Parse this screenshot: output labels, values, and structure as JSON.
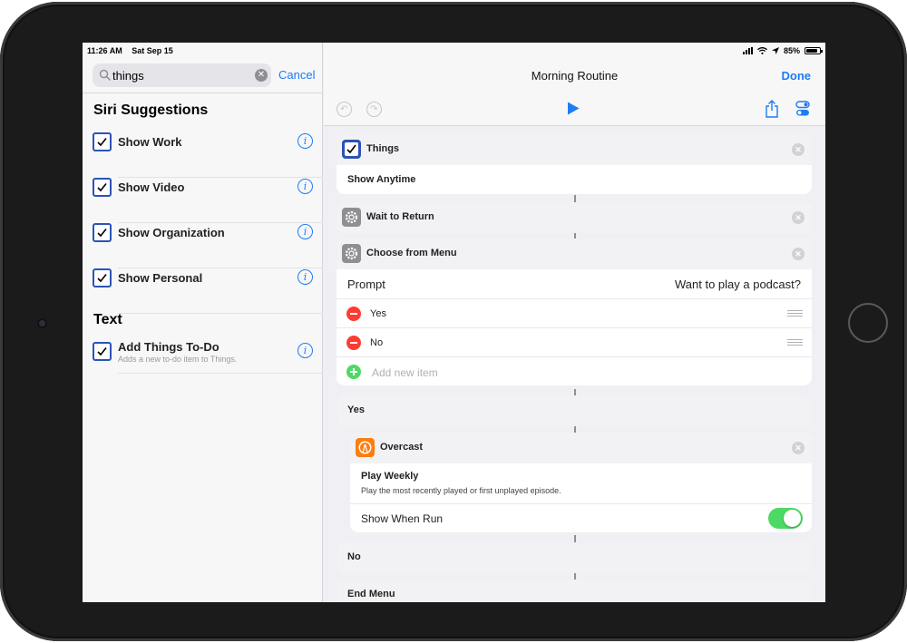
{
  "status_bar": {
    "time": "11:26 AM",
    "date": "Sat Sep 15",
    "battery": "85%"
  },
  "sidebar": {
    "search_value": "things",
    "cancel_label": "Cancel",
    "siri_section_title": "Siri Suggestions",
    "siri_items": [
      {
        "label": "Show Work"
      },
      {
        "label": "Show Video"
      },
      {
        "label": "Show Organization"
      },
      {
        "label": "Show Personal"
      }
    ],
    "text_section_title": "Text",
    "text_items": [
      {
        "label": "Add Things To-Do",
        "subtitle": "Adds a new to-do item to Things."
      }
    ]
  },
  "main": {
    "title": "Morning Routine",
    "done_label": "Done",
    "things_card": {
      "title": "Things",
      "row": "Show Anytime"
    },
    "wait_card": {
      "title": "Wait to Return"
    },
    "menu_card": {
      "title": "Choose from Menu",
      "prompt_label": "Prompt",
      "prompt_value": "Want to play a podcast?",
      "items": [
        "Yes",
        "No"
      ],
      "add_item_label": "Add new item"
    },
    "yes_label": "Yes",
    "overcast_card": {
      "title": "Overcast",
      "action": "Play Weekly",
      "description": "Play the most recently played or first unplayed episode.",
      "show_when_run_label": "Show When Run"
    },
    "no_label": "No",
    "end_menu_label": "End Menu"
  },
  "colors": {
    "accent": "#1e7cf5",
    "checkbox": "#2b53b8",
    "toggle_on": "#4cd964",
    "delete": "#ff3b30"
  }
}
